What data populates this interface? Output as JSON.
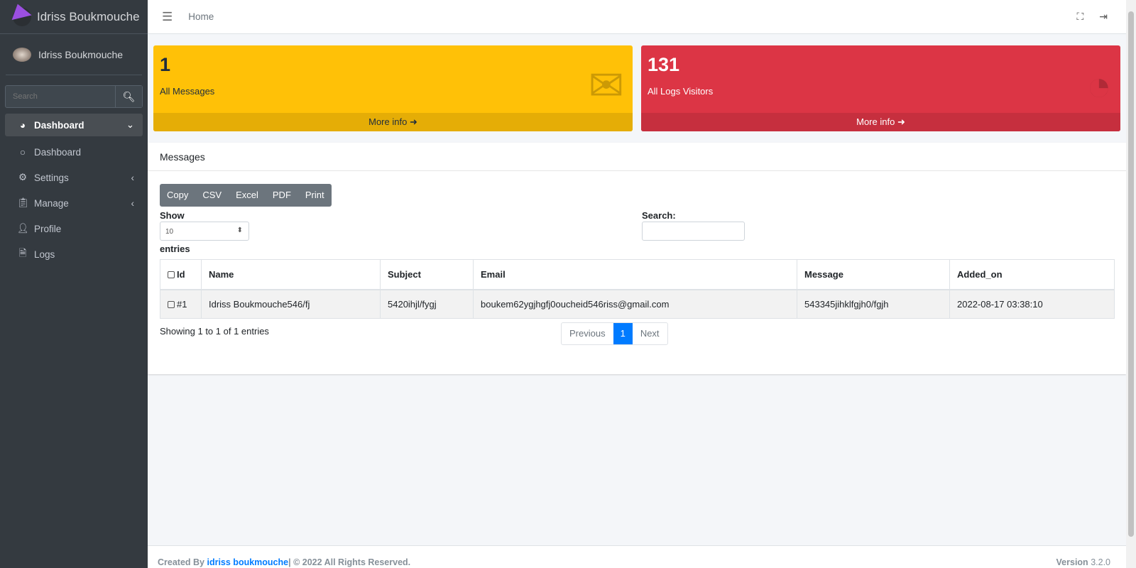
{
  "brand": {
    "name": "Idriss Boukmouche"
  },
  "user": {
    "name": "Idriss Boukmouche"
  },
  "sidebar": {
    "search_placeholder": "Search",
    "items": [
      {
        "label": "Dashboard",
        "icon": "tachometer-icon",
        "active": true
      },
      {
        "label": "Dashboard",
        "icon": "circle-icon"
      },
      {
        "label": "Settings",
        "icon": "gear-icon"
      },
      {
        "label": "Manage",
        "icon": "clipboard-icon"
      },
      {
        "label": "Profile",
        "icon": "user-icon"
      },
      {
        "label": "Logs",
        "icon": "file-icon"
      }
    ]
  },
  "topbar": {
    "home": "Home"
  },
  "cards": [
    {
      "value": "1",
      "label": "All Messages",
      "more": "More info",
      "color": "#ffc107",
      "icon": "envelope-icon"
    },
    {
      "value": "131",
      "label": "All Logs Visitors",
      "more": "More info",
      "color": "#dc3545",
      "icon": "pie-chart-icon"
    }
  ],
  "messages": {
    "title": "Messages",
    "buttons": [
      "Copy",
      "CSV",
      "Excel",
      "PDF",
      "Print"
    ],
    "show_label": "Show",
    "page_length": "10",
    "entries_label": "entries",
    "search_label": "Search:",
    "columns": [
      "Id",
      "Name",
      "Subject",
      "Email",
      "Message",
      "Added_on"
    ],
    "rows": [
      [
        "#1",
        "Idriss Boukmouche546/fj",
        "5420ihjl/fygj",
        "boukem62ygjhgfj0oucheid546riss@gmail.com",
        "543345jihklfgjh0/fgjh",
        "2022-08-17 03:38:10"
      ]
    ],
    "info": "Showing 1 to 1 of 1 entries",
    "pager": {
      "prev": "Previous",
      "current": "1",
      "next": "Next"
    }
  },
  "footer": {
    "created": "Created By ",
    "author": "idriss boukmouche",
    "rights": "| © 2022 All Rights Reserved.",
    "version_label": "Version",
    "version": "3.2.0"
  }
}
